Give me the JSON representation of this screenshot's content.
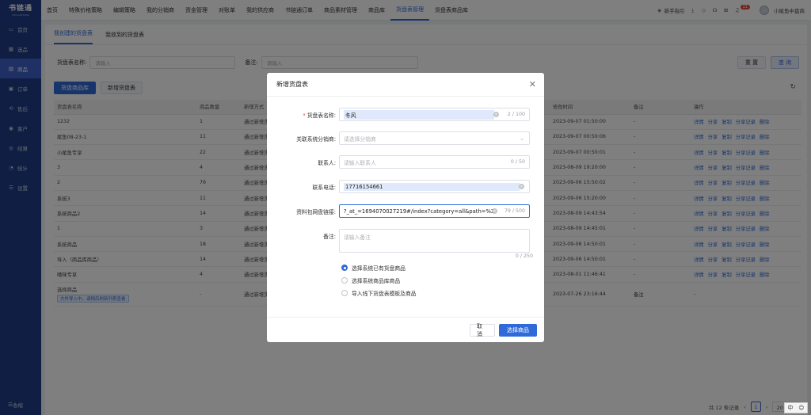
{
  "app": {
    "logo": "书链通",
    "logo_sub": "SHULIANTONG"
  },
  "sidebar": {
    "items": [
      {
        "label": "首页",
        "icon": "monitor-icon",
        "glyph": "▭"
      },
      {
        "label": "选品",
        "icon": "grid-icon",
        "glyph": "▦"
      },
      {
        "label": "商品",
        "icon": "box-icon",
        "glyph": "▤"
      },
      {
        "label": "订单",
        "icon": "order-icon",
        "glyph": "▣"
      },
      {
        "label": "售后",
        "icon": "refresh-icon",
        "glyph": "⟲"
      },
      {
        "label": "客户",
        "icon": "user-icon",
        "glyph": "◉"
      },
      {
        "label": "结算",
        "icon": "settle-icon",
        "glyph": "◎"
      },
      {
        "label": "统计",
        "icon": "stat-icon",
        "glyph": "◔"
      },
      {
        "label": "设置",
        "icon": "settings-icon",
        "glyph": "☰"
      }
    ],
    "active_index": 2,
    "collapse_label": "收缩"
  },
  "topnav": {
    "items": [
      "首页",
      "特殊价格策略",
      "编辑策略",
      "我的分销商",
      "资金管理",
      "对账单",
      "我的供应商",
      "书链通订单",
      "商品素材管理",
      "商品库",
      "货盘表管理",
      "货盘表商品库"
    ],
    "active_index": 10,
    "guide": "新手指引",
    "notif_count": "11",
    "user": "小尾鱼中盘商"
  },
  "page": {
    "tabs": [
      "我创建的货盘表",
      "我收到的货盘表"
    ],
    "active_tab": 0,
    "filter": {
      "name_label": "货盘表名称:",
      "name_placeholder": "请输入",
      "remark_label": "备注:",
      "remark_placeholder": "请输入",
      "reset": "重 置",
      "search": "查 询"
    },
    "actions": {
      "pallet_lib": "货盘商品库",
      "new_pallet": "新增货盘表"
    },
    "columns": [
      "货盘表名称",
      "商品数量",
      "新增方式",
      "",
      "",
      "修改时间",
      "备注",
      "操作"
    ],
    "rows": [
      {
        "name": "1232",
        "qty": "1",
        "mode": "通过新增货",
        "time": "2023-09-07 01:50:00",
        "remark": "-"
      },
      {
        "name": "尾鱼08-23-1",
        "qty": "11",
        "mode": "通过新增货",
        "time": "2023-09-07 00:50:06",
        "remark": "-"
      },
      {
        "name": "小尾鱼专享",
        "qty": "22",
        "mode": "通过新增货",
        "time": "2023-09-07 00:50:01",
        "remark": "-"
      },
      {
        "name": "3",
        "qty": "4",
        "mode": "通过新增货",
        "time": "2023-08-09 19:20:00",
        "remark": "-"
      },
      {
        "name": "2",
        "qty": "76",
        "mode": "通过新增货",
        "time": "2023-09-06 15:50:02",
        "remark": "-"
      },
      {
        "name": "系统3",
        "qty": "11",
        "mode": "通过新增货",
        "time": "2023-09-06 15:20:00",
        "remark": "-"
      },
      {
        "name": "系统商品2",
        "qty": "14",
        "mode": "通过新增货",
        "time": "2023-08-09 14:43:54",
        "remark": "-"
      },
      {
        "name": "1",
        "qty": "3",
        "mode": "通过新增货",
        "time": "2023-08-09 14:45:01",
        "remark": "-"
      },
      {
        "name": "系统商品",
        "qty": "18",
        "mode": "通过新增货",
        "time": "2023-09-06 14:50:01",
        "remark": "-"
      },
      {
        "name": "导入（商品库商品）",
        "qty": "14",
        "mode": "通过新增货",
        "time": "2023-09-06 14:50:01",
        "remark": "-"
      },
      {
        "name": "嘻咪专享",
        "qty": "4",
        "mode": "通过新增货",
        "time": "2023-08-01 11:46:41",
        "remark": "-"
      }
    ],
    "last_row": {
      "name": "选择商品",
      "tag": "文件导入中，请稍后刷新列表查看",
      "qty": "-",
      "mode": "通过新增货",
      "time": "2023-07-26 23:16:44",
      "remark": "备注",
      "op": "-"
    },
    "ops": [
      "详情",
      "分享",
      "复制",
      "分享记录",
      "删除"
    ],
    "pager": {
      "total": "共 12 条记录",
      "current": "1",
      "size": "20 条/页"
    }
  },
  "modal": {
    "title": "新增货盘表",
    "fields": {
      "name": {
        "label": "货盘表名称:",
        "value": "冬风",
        "count": "2 / 100"
      },
      "distributor": {
        "label": "关联系统分销商:",
        "placeholder": "请选择分销商"
      },
      "contact": {
        "label": "联系人:",
        "placeholder": "请输入联系人",
        "count": "0 / 50"
      },
      "phone": {
        "label": "联系电话:",
        "value": "17716154661"
      },
      "link": {
        "label": "资料包网盘链接:",
        "value": "?_at_=1694070027219#/index?category=all&path=%2F",
        "count": "79 / 500"
      },
      "remark": {
        "label": "备注:",
        "placeholder": "请输入备注",
        "count": "0 / 250"
      }
    },
    "options": [
      "选择系统已有货盘商品",
      "选择系统商品库商品",
      "导入线下货盘表模板及商品"
    ],
    "selected_option": 0,
    "cancel": "取 消",
    "confirm": "选择商品"
  },
  "ime": {
    "label": "中"
  }
}
